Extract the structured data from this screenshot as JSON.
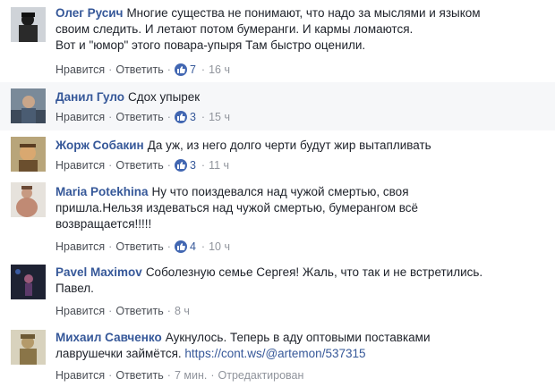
{
  "actions": {
    "like_label": "Нравится",
    "reply_label": "Ответить",
    "separator": "·"
  },
  "comments": [
    {
      "author": "Олег Русич",
      "lines": [
        "Многие существа не понимают, что надо за мыслями и языком",
        "своим следить. И летают потом бумеранги. И кармы ломаются.",
        "Вот и \"юмор\" этого повара-упыря Там быстро оценили."
      ],
      "likes": "7",
      "time": "16 ч",
      "avatar_icon": "user-photo-icon"
    },
    {
      "author": "Данил Гуло",
      "lines": [
        "Сдох упырек"
      ],
      "likes": "3",
      "time": "15 ч",
      "avatar_icon": "user-photo-icon"
    },
    {
      "author": "Жорж Собакин",
      "lines": [
        "Да уж, из него долго черти будут жир вытапливать"
      ],
      "likes": "3",
      "time": "11 ч",
      "avatar_icon": "user-photo-icon"
    },
    {
      "author": "Maria Potekhina",
      "lines": [
        "Ну что поиздевался над чужой смертью, своя",
        "пришла.Нельзя издеваться над чужой смертью, бумерангом всё",
        "возвращается!!!!!"
      ],
      "likes": "4",
      "time": "10 ч",
      "avatar_icon": "user-photo-icon"
    },
    {
      "author": "Pavel Maximov",
      "lines": [
        "Соболезную семье Сергея! Жаль, что так и не встретились.",
        "Павел."
      ],
      "time": "8 ч",
      "avatar_icon": "user-photo-icon"
    },
    {
      "author": "Михаил Савченко",
      "lines": [
        "Аукнулось. Теперь в аду оптовыми поставками",
        "лаврушечки займётся."
      ],
      "link": "https://cont.ws/@artemon/537315",
      "time": "7 мин.",
      "edited": "Отредактирован",
      "avatar_icon": "user-photo-icon"
    }
  ],
  "colors": {
    "link": "#365899",
    "meta": "#90949c",
    "like_badge": "#4267b2",
    "alt_row": "#f6f7f9"
  }
}
